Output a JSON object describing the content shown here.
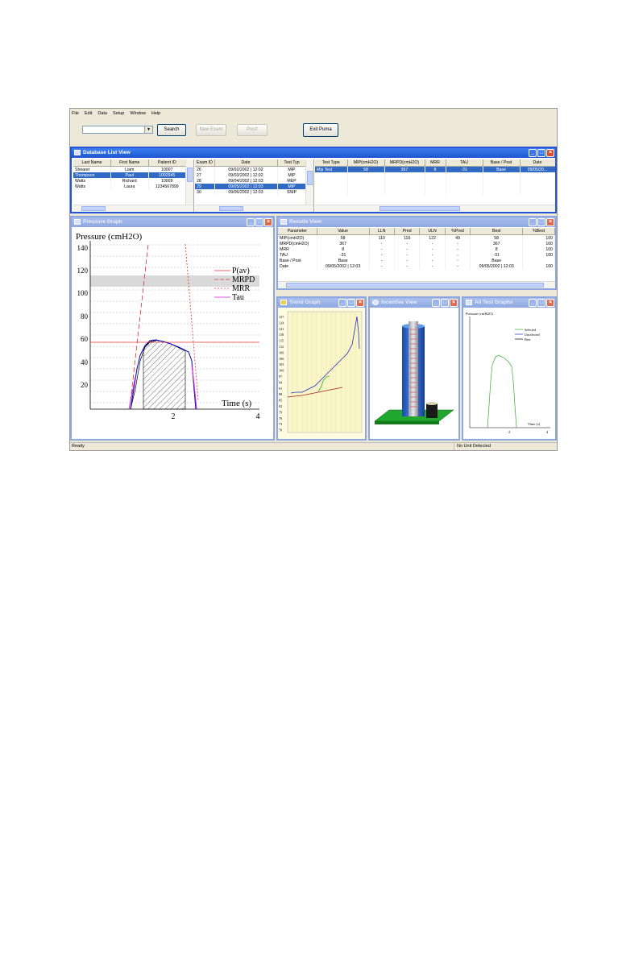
{
  "menu": [
    "File",
    "Edit",
    "Data",
    "Setup",
    "Window",
    "Help"
  ],
  "toolbar": {
    "search_label": "Search",
    "new_exam_label": "New Exam",
    "post_label": "Post!",
    "exit_label": "Exit Puma"
  },
  "db": {
    "title": "Database List View",
    "patients": {
      "headers": [
        "Last Name",
        "First Name",
        "Patient ID"
      ],
      "rows": [
        [
          "Shearer",
          "Liam",
          "10007"
        ],
        [
          "Thompson",
          "Paul",
          "1002945"
        ],
        [
          "Watts",
          "Richard",
          "10009"
        ],
        [
          "Watts",
          "Laura",
          "1234567899"
        ]
      ],
      "selected": 1
    },
    "exams": {
      "headers": [
        "Exam ID",
        "Date",
        "Test Typ"
      ],
      "rows": [
        [
          "26",
          "09/02/2002 | 12:02",
          "MIP"
        ],
        [
          "27",
          "09/03/2002 | 12:02",
          "MIP"
        ],
        [
          "28",
          "09/04/2002 | 12:03",
          "MEP"
        ],
        [
          "29",
          "09/05/2002 | 12:03",
          "MIP"
        ],
        [
          "30",
          "09/06/2002 | 12:03",
          "SNIP"
        ]
      ],
      "selected": 3
    },
    "tests": {
      "headers": [
        "Test Type",
        "MIP(cmH2O)",
        "MRPD(cmH2O)",
        "MRR",
        "TAU",
        "Base / Post",
        "Date"
      ],
      "rows": [
        [
          "Mip Test",
          "58",
          "367",
          "8",
          "-31",
          "Base",
          "09/05/20..."
        ]
      ],
      "selected": 0
    }
  },
  "pressure": {
    "title": "Pressure Graph",
    "ylabel": "Pressure (cmH2O)",
    "xlabel": "Time (s)",
    "yticks": [
      "140",
      "120",
      "100",
      "80",
      "60",
      "40",
      "20"
    ],
    "xticks": [
      "2",
      "4"
    ],
    "legend": [
      "P(av)",
      "MRPD",
      "MRR",
      "Tau"
    ]
  },
  "results": {
    "title": "Results View",
    "headers": [
      "Parameter",
      "Value",
      "LLN",
      "Pred",
      "ULN",
      "%Pred",
      "Best",
      "%Best"
    ],
    "rows": [
      [
        "MIP(cmH2O)",
        "58",
        "110",
        "116",
        "122",
        "49",
        "58",
        "100"
      ],
      [
        "MRPD(cmH2O)",
        "367",
        "-",
        "-",
        "-",
        "-",
        "367",
        "100"
      ],
      [
        "MRR",
        "8",
        "-",
        "-",
        "-",
        "-",
        "8",
        "100"
      ],
      [
        "TAU",
        "-31",
        "-",
        "-",
        "-",
        "-",
        "-31",
        "100"
      ],
      [
        "Base / Post",
        "Base",
        "-",
        "-",
        "-",
        "-",
        "Base",
        ""
      ],
      [
        "Date",
        "09/05/2002 | 12:03",
        "-",
        "-",
        "-",
        "-",
        "09/05/2002 | 12:03",
        "100"
      ]
    ]
  },
  "trend": {
    "title": "Trend Graph",
    "yticks": [
      "127",
      "124",
      "121",
      "118",
      "115",
      "112",
      "109",
      "106",
      "103",
      "100",
      "97",
      "94",
      "91",
      "88",
      "85",
      "82",
      "79",
      "76",
      "73",
      "70"
    ]
  },
  "incentive": {
    "title": "Incentive View"
  },
  "alltests": {
    "title": "All Test Graphs",
    "ylabel": "Pressure (cmH2O)",
    "xlabel": "Time (s)",
    "legend": [
      "Selected",
      "Unselected",
      "Best"
    ],
    "xticks": [
      "2",
      "4"
    ]
  },
  "status": {
    "left": "Ready",
    "right": "No Unit Detected"
  },
  "colors": {
    "titlebar": "#2454d8",
    "selection": "#316ac5",
    "close": "#e04a2a"
  }
}
